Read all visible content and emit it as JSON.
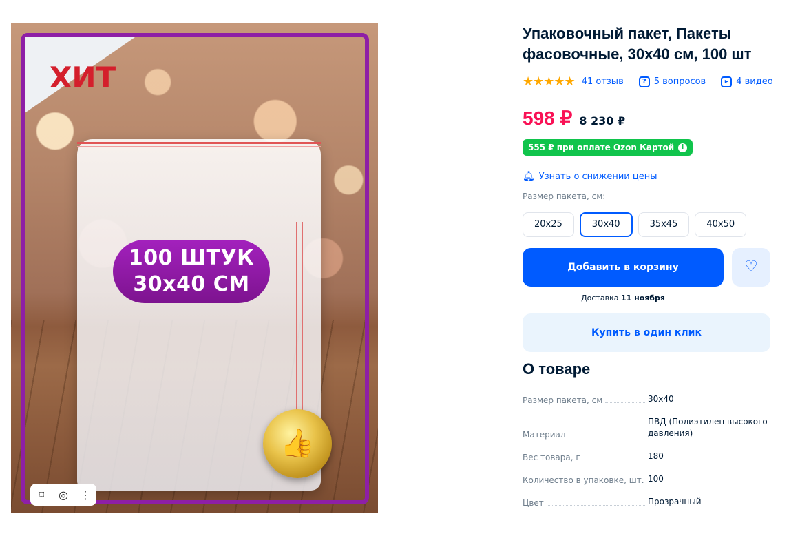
{
  "gallery": {
    "badge": "ХИТ",
    "pill_line1": "100 ШТУК",
    "pill_line2": "30x40 СМ",
    "toolbar_icons": [
      "bookmark-icon",
      "camera-search-icon",
      "more-icon"
    ]
  },
  "product": {
    "title": "Упаковочный пакет, Пакеты фасовочные, 30х40 см, 100 шт",
    "rating_stars": 5,
    "reviews": "41 отзыв",
    "questions": "5 вопросов",
    "videos": "4 видео"
  },
  "pricing": {
    "price": "598 ₽",
    "old_price": "8 230 ₽",
    "ozon_card_offer": "555 ₽ при оплате Ozon Картой",
    "notify_label": "Узнать о снижении цены",
    "colors": {
      "price": "#f91155",
      "accent": "#005bff",
      "ozon_badge": "#10c44c"
    }
  },
  "variants": {
    "label": "Размер пакета, см:",
    "options": [
      "20x25",
      "30x40",
      "35x45",
      "40x50"
    ],
    "selected": "30x40"
  },
  "actions": {
    "add_to_cart": "Добавить в корзину",
    "delivery_prefix": "Доставка",
    "delivery_date": "11 ноября",
    "buy_one_click": "Купить в один клик"
  },
  "about": {
    "heading": "О товаре",
    "specs": [
      {
        "name": "Размер пакета, см",
        "value": "30х40"
      },
      {
        "name": "Материал",
        "value": "ПВД (Полиэтилен высокого давления)"
      },
      {
        "name": "Вес товара, г",
        "value": "180"
      },
      {
        "name": "Количество в упаковке, шт.",
        "value": "100"
      },
      {
        "name": "Цвет",
        "value": "Прозрачный"
      }
    ]
  }
}
